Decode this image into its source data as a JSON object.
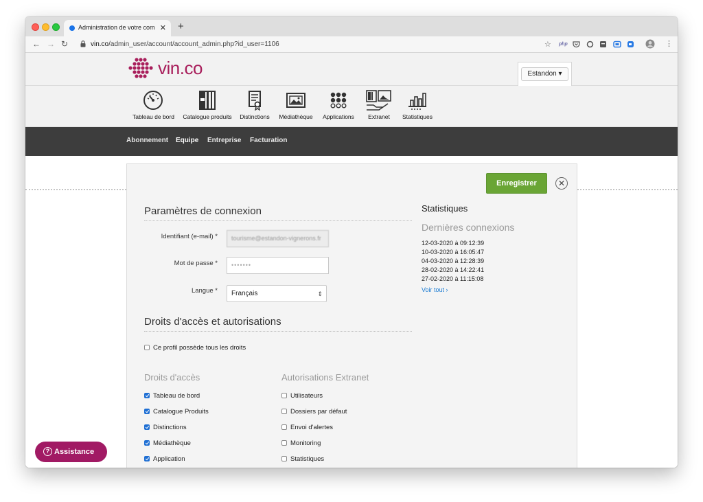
{
  "browser": {
    "tab_title": "Administration de votre compte",
    "tab_close": "✕",
    "new_tab": "+",
    "url_host": "vin.co",
    "url_path": "/admin_user/account/account_admin.php?id_user=1106",
    "ext_php": "php"
  },
  "site": {
    "logo_text": "vin",
    "logo_tld": ".co",
    "account_label": "Estandon ▾",
    "brand_color": "#a81e5b"
  },
  "modules": [
    {
      "label": "Tableau de bord",
      "icon": "gauge-icon"
    },
    {
      "label": "Catalogue produits",
      "icon": "binder-icon"
    },
    {
      "label": "Distinctions",
      "icon": "certificate-icon"
    },
    {
      "label": "Médiathèque",
      "icon": "picture-icon"
    },
    {
      "label": "Applications",
      "icon": "grid-dots-icon"
    },
    {
      "label": "Extranet",
      "icon": "extranet-icon"
    },
    {
      "label": "Statistiques",
      "icon": "bar-chart-icon"
    }
  ],
  "subnav": [
    {
      "label": "Abonnement",
      "active": false
    },
    {
      "label": "Equipe",
      "active": true
    },
    {
      "label": "Entreprise",
      "active": false
    },
    {
      "label": "Facturation",
      "active": false
    }
  ],
  "panel": {
    "save_label": "Enregistrer",
    "close_symbol": "✕",
    "connection": {
      "title": "Paramètres de connexion",
      "email_label": "Identifiant (e-mail) *",
      "email_value": "tourisme@estandon-vignerons.fr",
      "password_label": "Mot de passe *",
      "password_value": "•••••••",
      "language_label": "Langue *",
      "language_value": "Français"
    },
    "stats": {
      "title": "Statistiques",
      "subtitle": "Dernières connexions",
      "logins": [
        "12-03-2020 à 09:12:39",
        "10-03-2020 à 16:05:47",
        "04-03-2020 à 12:28:39",
        "28-02-2020 à 14:22:41",
        "27-02-2020 à 11:15:08"
      ],
      "see_all": "Voir tout ›"
    },
    "rights": {
      "title": "Droits d'accès et autorisations",
      "all_rights_label": "Ce profil possède tous les droits",
      "access_title": "Droits d'accès",
      "access_items": [
        {
          "label": "Tableau de bord",
          "checked": true
        },
        {
          "label": "Catalogue Produits",
          "checked": true
        },
        {
          "label": "Distinctions",
          "checked": true
        },
        {
          "label": "Médiathèque",
          "checked": true
        },
        {
          "label": "Application",
          "checked": true
        }
      ],
      "extranet_title": "Autorisations Extranet",
      "extranet_items": [
        {
          "label": "Utilisateurs",
          "checked": false
        },
        {
          "label": "Dossiers par défaut",
          "checked": false
        },
        {
          "label": "Envoi d'alertes",
          "checked": false
        },
        {
          "label": "Monitoring",
          "checked": false
        },
        {
          "label": "Statistiques",
          "checked": false
        }
      ]
    }
  },
  "assistance": {
    "label": "Assistance",
    "icon_glyph": "?",
    "color": "#a11a64"
  },
  "colors": {
    "save_button": "#6aa535",
    "subnav_bg": "#3d3d3d",
    "checkbox_on": "#1f6fd3",
    "link": "#1a7bd2"
  }
}
